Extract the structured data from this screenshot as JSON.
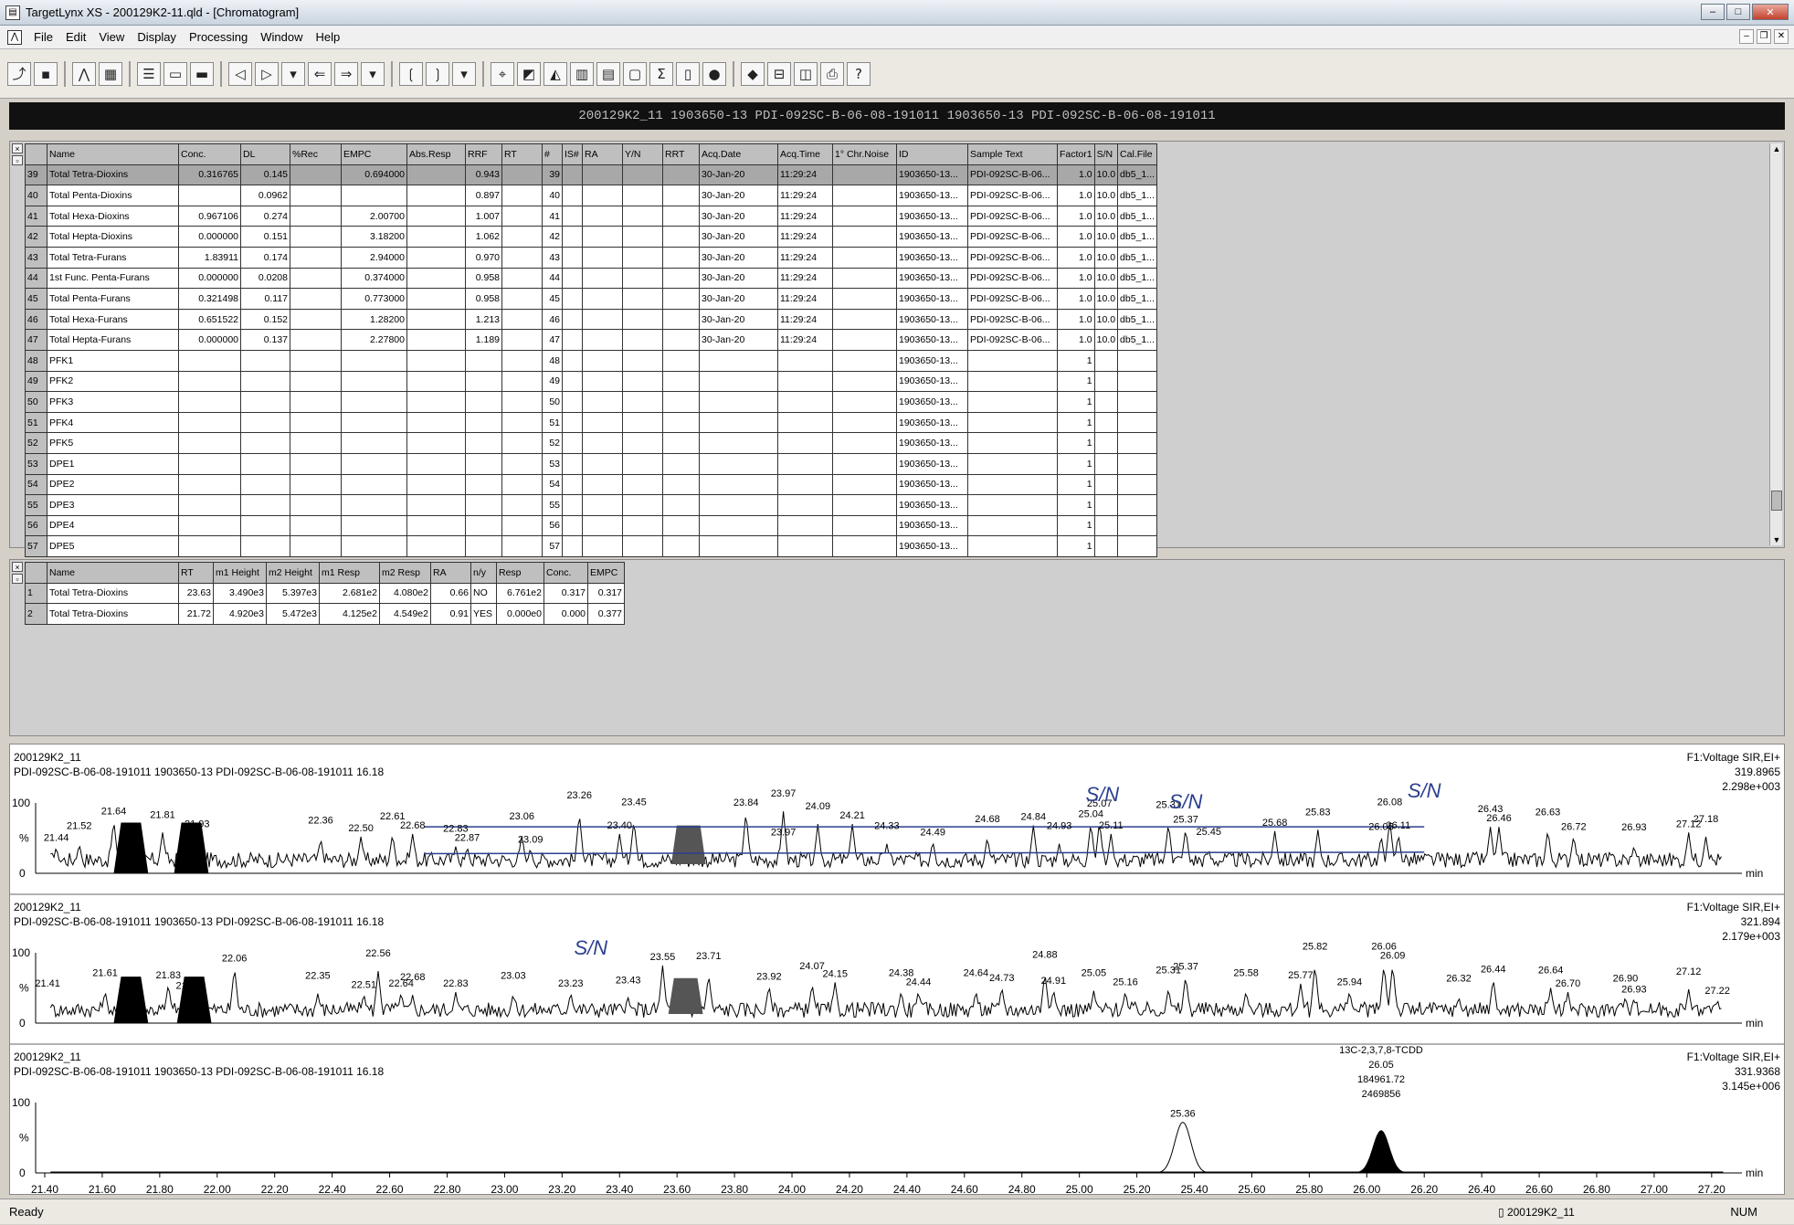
{
  "window": {
    "title": "TargetLynx XS - 200129K2-11.qld - [Chromatogram]"
  },
  "menu": [
    "File",
    "Edit",
    "View",
    "Display",
    "Processing",
    "Window",
    "Help"
  ],
  "namebar": {
    "text": "200129K2_11 1903650-13 PDI-092SC-B-06-08-191011 1903650-13 PDI-092SC-B-06-08-191011"
  },
  "grid": {
    "columns": [
      "",
      "Name",
      "Conc.",
      "DL",
      "%Rec",
      "EMPC",
      "Abs.Resp",
      "RRF",
      "RT",
      "#",
      "IS#",
      "RA",
      "Y/N",
      "RRT",
      "Acq.Date",
      "Acq.Time",
      "1° Chr.Noise",
      "ID",
      "Sample Text",
      "Factor1",
      "S/N",
      "Cal.File"
    ],
    "rows": [
      [
        "39",
        "Total Tetra-Dioxins",
        "0.316765",
        "0.145",
        "",
        "0.694000",
        "",
        "0.943",
        "",
        "39",
        "",
        "",
        "",
        "",
        "30-Jan-20",
        "11:29:24",
        "",
        "1903650-13...",
        "PDI-092SC-B-06...",
        "1.0",
        "10.0",
        "db5_1..."
      ],
      [
        "40",
        "Total Penta-Dioxins",
        "",
        "0.0962",
        "",
        "",
        "",
        "0.897",
        "",
        "40",
        "",
        "",
        "",
        "",
        "30-Jan-20",
        "11:29:24",
        "",
        "1903650-13...",
        "PDI-092SC-B-06...",
        "1.0",
        "10.0",
        "db5_1..."
      ],
      [
        "41",
        "Total Hexa-Dioxins",
        "0.967106",
        "0.274",
        "",
        "2.00700",
        "",
        "1.007",
        "",
        "41",
        "",
        "",
        "",
        "",
        "30-Jan-20",
        "11:29:24",
        "",
        "1903650-13...",
        "PDI-092SC-B-06...",
        "1.0",
        "10.0",
        "db5_1..."
      ],
      [
        "42",
        "Total Hepta-Dioxins",
        "0.000000",
        "0.151",
        "",
        "3.18200",
        "",
        "1.062",
        "",
        "42",
        "",
        "",
        "",
        "",
        "30-Jan-20",
        "11:29:24",
        "",
        "1903650-13...",
        "PDI-092SC-B-06...",
        "1.0",
        "10.0",
        "db5_1..."
      ],
      [
        "43",
        "Total Tetra-Furans",
        "1.83911",
        "0.174",
        "",
        "2.94000",
        "",
        "0.970",
        "",
        "43",
        "",
        "",
        "",
        "",
        "30-Jan-20",
        "11:29:24",
        "",
        "1903650-13...",
        "PDI-092SC-B-06...",
        "1.0",
        "10.0",
        "db5_1..."
      ],
      [
        "44",
        "1st Func. Penta-Furans",
        "0.000000",
        "0.0208",
        "",
        "0.374000",
        "",
        "0.958",
        "",
        "44",
        "",
        "",
        "",
        "",
        "30-Jan-20",
        "11:29:24",
        "",
        "1903650-13...",
        "PDI-092SC-B-06...",
        "1.0",
        "10.0",
        "db5_1..."
      ],
      [
        "45",
        "Total Penta-Furans",
        "0.321498",
        "0.117",
        "",
        "0.773000",
        "",
        "0.958",
        "",
        "45",
        "",
        "",
        "",
        "",
        "30-Jan-20",
        "11:29:24",
        "",
        "1903650-13...",
        "PDI-092SC-B-06...",
        "1.0",
        "10.0",
        "db5_1..."
      ],
      [
        "46",
        "Total Hexa-Furans",
        "0.651522",
        "0.152",
        "",
        "1.28200",
        "",
        "1.213",
        "",
        "46",
        "",
        "",
        "",
        "",
        "30-Jan-20",
        "11:29:24",
        "",
        "1903650-13...",
        "PDI-092SC-B-06...",
        "1.0",
        "10.0",
        "db5_1..."
      ],
      [
        "47",
        "Total Hepta-Furans",
        "0.000000",
        "0.137",
        "",
        "2.27800",
        "",
        "1.189",
        "",
        "47",
        "",
        "",
        "",
        "",
        "30-Jan-20",
        "11:29:24",
        "",
        "1903650-13...",
        "PDI-092SC-B-06...",
        "1.0",
        "10.0",
        "db5_1..."
      ],
      [
        "48",
        "PFK1",
        "",
        "",
        "",
        "",
        "",
        "",
        "",
        "48",
        "",
        "",
        "",
        "",
        "",
        "",
        "",
        "1903650-13...",
        "",
        "1",
        "",
        ""
      ],
      [
        "49",
        "PFK2",
        "",
        "",
        "",
        "",
        "",
        "",
        "",
        "49",
        "",
        "",
        "",
        "",
        "",
        "",
        "",
        "1903650-13...",
        "",
        "1",
        "",
        ""
      ],
      [
        "50",
        "PFK3",
        "",
        "",
        "",
        "",
        "",
        "",
        "",
        "50",
        "",
        "",
        "",
        "",
        "",
        "",
        "",
        "1903650-13...",
        "",
        "1",
        "",
        ""
      ],
      [
        "51",
        "PFK4",
        "",
        "",
        "",
        "",
        "",
        "",
        "",
        "51",
        "",
        "",
        "",
        "",
        "",
        "",
        "",
        "1903650-13...",
        "",
        "1",
        "",
        ""
      ],
      [
        "52",
        "PFK5",
        "",
        "",
        "",
        "",
        "",
        "",
        "",
        "52",
        "",
        "",
        "",
        "",
        "",
        "",
        "",
        "1903650-13...",
        "",
        "1",
        "",
        ""
      ],
      [
        "53",
        "DPE1",
        "",
        "",
        "",
        "",
        "",
        "",
        "",
        "53",
        "",
        "",
        "",
        "",
        "",
        "",
        "",
        "1903650-13...",
        "",
        "1",
        "",
        ""
      ],
      [
        "54",
        "DPE2",
        "",
        "",
        "",
        "",
        "",
        "",
        "",
        "54",
        "",
        "",
        "",
        "",
        "",
        "",
        "",
        "1903650-13...",
        "",
        "1",
        "",
        ""
      ],
      [
        "55",
        "DPE3",
        "",
        "",
        "",
        "",
        "",
        "",
        "",
        "55",
        "",
        "",
        "",
        "",
        "",
        "",
        "",
        "1903650-13...",
        "",
        "1",
        "",
        ""
      ],
      [
        "56",
        "DPE4",
        "",
        "",
        "",
        "",
        "",
        "",
        "",
        "56",
        "",
        "",
        "",
        "",
        "",
        "",
        "",
        "1903650-13...",
        "",
        "1",
        "",
        ""
      ],
      [
        "57",
        "DPE5",
        "",
        "",
        "",
        "",
        "",
        "",
        "",
        "57",
        "",
        "",
        "",
        "",
        "",
        "",
        "",
        "1903650-13...",
        "",
        "1",
        "",
        ""
      ]
    ]
  },
  "peaks": {
    "columns": [
      "",
      "Name",
      "RT",
      "m1 Height",
      "m2 Height",
      "m1 Resp",
      "m2 Resp",
      "RA",
      "n/y",
      "Resp",
      "Conc.",
      "EMPC"
    ],
    "rows": [
      [
        "1",
        "Total Tetra-Dioxins",
        "23.63",
        "3.490e3",
        "5.397e3",
        "2.681e2",
        "4.080e2",
        "0.66",
        "NO",
        "6.761e2",
        "0.317",
        "0.317"
      ],
      [
        "2",
        "Total Tetra-Dioxins",
        "21.72",
        "4.920e3",
        "5.472e3",
        "4.125e2",
        "4.549e2",
        "0.91",
        "YES",
        "0.000e0",
        "0.000",
        "0.377"
      ]
    ]
  },
  "traces": [
    {
      "sample": "200129K2_11",
      "desc": "PDI-092SC-B-06-08-191011 1903650-13 PDI-092SC-B-06-08-191011 16.18",
      "func": "F1:Voltage SIR,EI+",
      "mass": "319.8965",
      "intensity": "2.298e+003",
      "labels": [
        [
          "21.44",
          21.44,
          0.38
        ],
        [
          "21.52",
          21.52,
          0.42
        ],
        [
          "21.64",
          21.64,
          0.76
        ],
        [
          "21.81",
          21.81,
          0.58
        ],
        [
          "21.93",
          21.93,
          0.58
        ],
        [
          "22.36",
          22.36,
          0.5
        ],
        [
          "22.50",
          22.5,
          0.52
        ],
        [
          "22.61",
          22.61,
          0.56
        ],
        [
          "22.68",
          22.68,
          0.56
        ],
        [
          "22.83",
          22.83,
          0.38
        ],
        [
          "22.87",
          22.87,
          0.38
        ],
        [
          "23.06",
          23.06,
          0.56
        ],
        [
          "23.09",
          23.09,
          0.36
        ],
        [
          "23.26",
          23.26,
          0.86
        ],
        [
          "23.40",
          23.4,
          0.56
        ],
        [
          "23.45",
          23.45,
          0.76
        ],
        [
          "23.84",
          23.84,
          0.88
        ],
        [
          "23.97",
          23.97,
          0.88
        ],
        [
          "23.97",
          23.97,
          0.46
        ],
        [
          "24.09",
          24.09,
          0.7
        ],
        [
          "24.21",
          24.21,
          0.7
        ],
        [
          "24.33",
          24.33,
          0.42
        ],
        [
          "24.49",
          24.49,
          0.46
        ],
        [
          "24.68",
          24.68,
          0.52
        ],
        [
          "24.84",
          24.84,
          0.68
        ],
        [
          "24.93",
          24.93,
          0.42
        ],
        [
          "25.04",
          25.04,
          0.72
        ],
        [
          "25.07",
          25.07,
          0.74
        ],
        [
          "25.11",
          25.11,
          0.56
        ],
        [
          "25.31",
          25.31,
          0.72
        ],
        [
          "25.37",
          25.37,
          0.64
        ],
        [
          "25.45",
          25.45,
          0.34
        ],
        [
          "25.68",
          25.68,
          0.6
        ],
        [
          "25.83",
          25.83,
          0.62
        ],
        [
          "26.05",
          26.05,
          0.54
        ],
        [
          "26.08",
          26.08,
          0.76
        ],
        [
          "26.11",
          26.11,
          0.56
        ],
        [
          "26.43",
          26.43,
          0.66
        ],
        [
          "26.46",
          26.46,
          0.66
        ],
        [
          "26.63",
          26.63,
          0.62
        ],
        [
          "26.72",
          26.72,
          0.54
        ],
        [
          "26.93",
          26.93,
          0.4
        ],
        [
          "27.12",
          27.12,
          0.58
        ],
        [
          "27.18",
          27.18,
          0.52
        ]
      ]
    },
    {
      "sample": "200129K2_11",
      "desc": "PDI-092SC-B-06-08-191011 1903650-13 PDI-092SC-B-06-08-191011 16.18",
      "func": "F1:Voltage SIR,EI+",
      "mass": "321.894",
      "intensity": "2.179e+003",
      "labels": [
        [
          "21.41",
          21.41,
          0.44
        ],
        [
          "21.61",
          21.61,
          0.46
        ],
        [
          "21.83",
          21.83,
          0.56
        ],
        [
          "21.90",
          21.9,
          0.28
        ],
        [
          "22.06",
          22.06,
          0.8
        ],
        [
          "22.35",
          22.35,
          0.42
        ],
        [
          "22.51",
          22.51,
          0.42
        ],
        [
          "22.56",
          22.56,
          0.74
        ],
        [
          "22.64",
          22.64,
          0.44
        ],
        [
          "22.68",
          22.68,
          0.4
        ],
        [
          "22.83",
          22.83,
          0.44
        ],
        [
          "23.03",
          23.03,
          0.42
        ],
        [
          "23.23",
          23.23,
          0.44
        ],
        [
          "23.43",
          23.43,
          0.36
        ],
        [
          "23.55",
          23.55,
          0.82
        ],
        [
          "23.71",
          23.71,
          0.7
        ],
        [
          "23.92",
          23.92,
          0.54
        ],
        [
          "24.07",
          24.07,
          0.56
        ],
        [
          "24.15",
          24.15,
          0.58
        ],
        [
          "24.38",
          24.38,
          0.46
        ],
        [
          "24.44",
          24.44,
          0.46
        ],
        [
          "24.64",
          24.64,
          0.46
        ],
        [
          "24.73",
          24.73,
          0.52
        ],
        [
          "24.88",
          24.88,
          0.72
        ],
        [
          "24.91",
          24.91,
          0.48
        ],
        [
          "25.05",
          25.05,
          0.46
        ],
        [
          "25.16",
          25.16,
          0.46
        ],
        [
          "25.31",
          25.31,
          0.5
        ],
        [
          "25.37",
          25.37,
          0.68
        ],
        [
          "25.58",
          25.58,
          0.46
        ],
        [
          "25.77",
          25.77,
          0.56
        ],
        [
          "25.82",
          25.82,
          0.84
        ],
        [
          "25.94",
          25.94,
          0.46
        ],
        [
          "26.06",
          26.06,
          0.84
        ],
        [
          "26.09",
          26.09,
          0.84
        ],
        [
          "26.32",
          26.32,
          0.38
        ],
        [
          "26.44",
          26.44,
          0.64
        ],
        [
          "26.64",
          26.64,
          0.5
        ],
        [
          "26.70",
          26.7,
          0.44
        ],
        [
          "26.90",
          26.9,
          0.38
        ],
        [
          "26.93",
          26.93,
          0.36
        ],
        [
          "27.12",
          27.12,
          0.48
        ],
        [
          "27.22",
          27.22,
          0.34
        ]
      ]
    },
    {
      "sample": "200129K2_11",
      "desc": "PDI-092SC-B-06-08-191011 1903650-13 PDI-092SC-B-06-08-191011 16.18",
      "func": "F1:Voltage SIR,EI+",
      "mass": "331.9368",
      "intensity": "3.145e+006",
      "labels": [
        [
          "25.36",
          25.36,
          0.72
        ]
      ],
      "peak_annotation": [
        "13C-2,3,7,8-TCDD",
        "26.05",
        "184961.72",
        "2469856"
      ]
    }
  ],
  "y_ticks": [
    "100",
    "%",
    "0"
  ],
  "x_unit": "min",
  "x_ticks": [
    "21.40",
    "21.60",
    "21.80",
    "22.00",
    "22.20",
    "22.40",
    "22.60",
    "22.80",
    "23.00",
    "23.20",
    "23.40",
    "23.60",
    "23.80",
    "24.00",
    "24.20",
    "24.40",
    "24.60",
    "24.80",
    "25.00",
    "25.20",
    "25.40",
    "25.60",
    "25.80",
    "26.00",
    "26.20",
    "26.40",
    "26.60",
    "26.80",
    "27.00",
    "27.20"
  ],
  "handwritten": [
    "S/N",
    "S/N",
    "S/N",
    "S/N"
  ],
  "status": {
    "left": "Ready",
    "sample": "200129K2_11",
    "right": "NUM"
  }
}
